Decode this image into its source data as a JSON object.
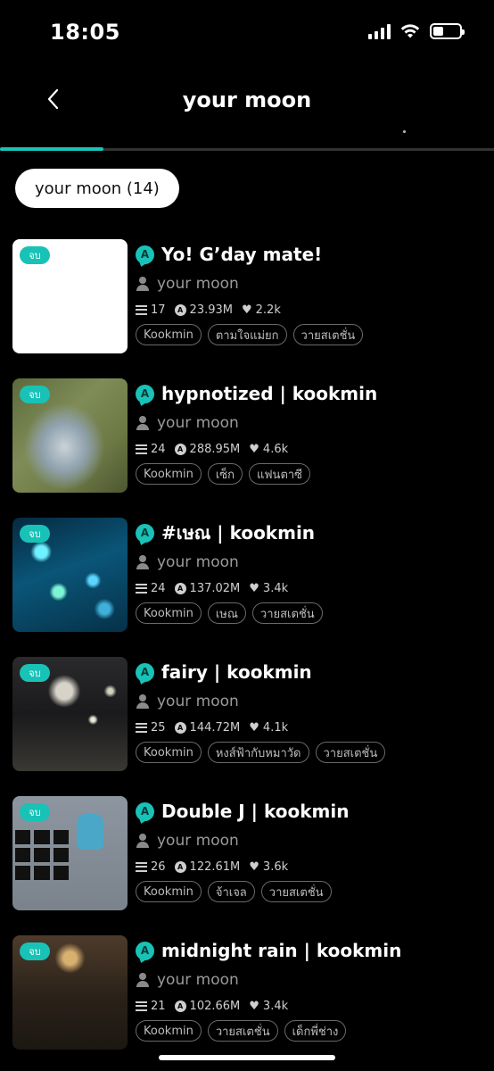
{
  "status_bar": {
    "time": "18:05"
  },
  "header": {
    "title": "your moon"
  },
  "filter": {
    "label": "your moon (14)"
  },
  "stories": [
    {
      "badge": "จบ",
      "title": "Yo! G’day mate!",
      "author": "your moon",
      "chapters": "17",
      "reads": "23.93M",
      "likes": "2.2k",
      "tags": [
        "Kookmin",
        "ตามใจแม่ยก",
        "วายสเตชั่น"
      ]
    },
    {
      "badge": "จบ",
      "title": "hypnotized | kookmin",
      "author": "your moon",
      "chapters": "24",
      "reads": "288.95M",
      "likes": "4.6k",
      "tags": [
        "Kookmin",
        "เซ็ก",
        "แฟนตาซี"
      ]
    },
    {
      "badge": "จบ",
      "title": "#เษณ | kookmin",
      "author": "your moon",
      "chapters": "24",
      "reads": "137.02M",
      "likes": "3.4k",
      "tags": [
        "Kookmin",
        "เษณ",
        "วายสเตชั่น"
      ]
    },
    {
      "badge": "จบ",
      "title": "fairy | kookmin",
      "author": "your moon",
      "chapters": "25",
      "reads": "144.72M",
      "likes": "4.1k",
      "tags": [
        "Kookmin",
        "หงส์ฟ้ากับหมาวัด",
        "วายสเตชั่น"
      ]
    },
    {
      "badge": "จบ",
      "title": "Double J | kookmin",
      "author": "your moon",
      "chapters": "26",
      "reads": "122.61M",
      "likes": "3.6k",
      "tags": [
        "Kookmin",
        "จ้าเจล",
        "วายสเตชั่น"
      ]
    },
    {
      "badge": "จบ",
      "title": "midnight rain | kookmin",
      "author": "your moon",
      "chapters": "21",
      "reads": "102.66M",
      "likes": "3.4k",
      "tags": [
        "Kookmin",
        "วายสเตชั่น",
        "เด็กพี่ช่าง"
      ]
    }
  ],
  "colors": {
    "accent": "#19c2b6",
    "background": "#000000"
  }
}
